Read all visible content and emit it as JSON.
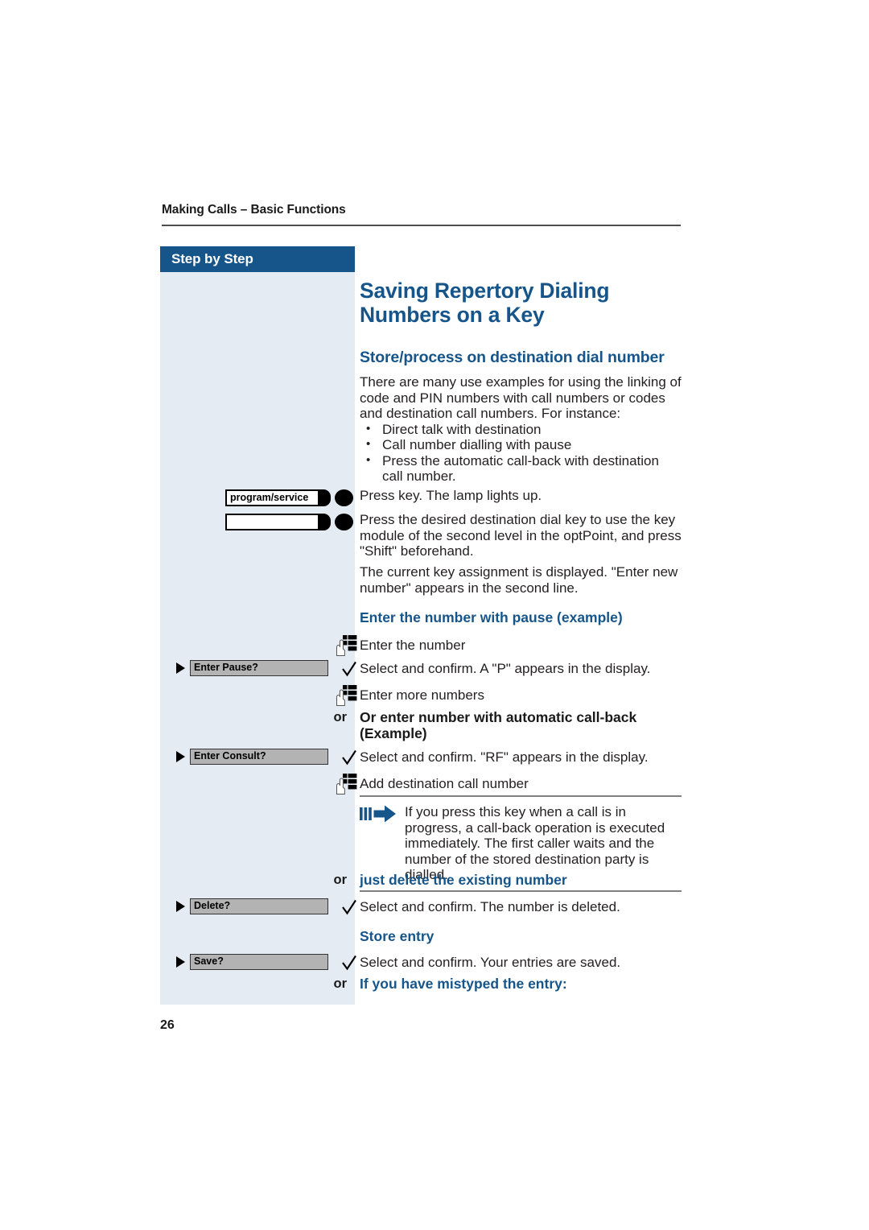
{
  "running_head": "Making Calls – Basic Functions",
  "sidebar": {
    "header_label": "Step by Step"
  },
  "page_number": "26",
  "content": {
    "title": "Saving Repertory Dialing Numbers on a Key",
    "subtitle": "Store/process on destination dial number",
    "intro": "There are many use examples for using the linking of code and PIN numbers with call numbers or codes and destination call numbers. For instance:",
    "bullets": [
      "Direct talk with destination",
      "Call number dialling with pause",
      "Press the automatic call-back with destination call number."
    ]
  },
  "steps": [
    {
      "id": "program-service",
      "key_label": "program/service",
      "text": "Press key. The lamp lights up."
    },
    {
      "id": "destination-dial-key",
      "key_label": "",
      "text": "Press the desired destination dial key to use the key module of the second level in the optPoint, and press \"Shift\" beforehand."
    },
    {
      "id": "current-assignment",
      "text": "The current key assignment is displayed. \"Enter new number\" appears in the second line."
    }
  ],
  "section_pause": {
    "heading": "Enter the number with pause (example)",
    "enter_number_text": "Enter the number",
    "option_label": "Enter Pause?",
    "option_text": "Select and confirm. A \"P\" appears in the display.",
    "enter_more_text": "Enter more numbers"
  },
  "section_callback": {
    "or_label": "or",
    "heading": "Or enter number with automatic call-back (Example)",
    "option_label": "Enter Consult?",
    "option_text": "Select and confirm. \"RF\" appears in the display.",
    "add_number_text": "Add destination call number"
  },
  "note": {
    "text": "If you press this key when a call is in progress, a call-back operation is executed immediately. The first caller waits and the number of the stored destination party is dialled."
  },
  "section_delete": {
    "or_label": "or",
    "heading": "just delete the existing number",
    "option_label": "Delete?",
    "option_text": "Select and confirm. The number is deleted."
  },
  "section_store": {
    "heading": "Store entry",
    "option_label": "Save?",
    "option_text": "Select and confirm. Your entries are saved."
  },
  "section_mistyped": {
    "or_label": "or",
    "heading": "If you have mistyped the entry:"
  },
  "icons": {
    "keypad": "keypad-hand-icon",
    "check": "checkmark-icon",
    "menu_arrow": "triangle-right-icon",
    "note_arrow": "note-arrow-icon",
    "key_lamp": "key-lamp-icon"
  },
  "colors": {
    "brand_blue": "#16558a",
    "sidebar_fill": "#e4ebf2",
    "option_fill": "#b3b3b3",
    "body_text": "#231f20"
  }
}
